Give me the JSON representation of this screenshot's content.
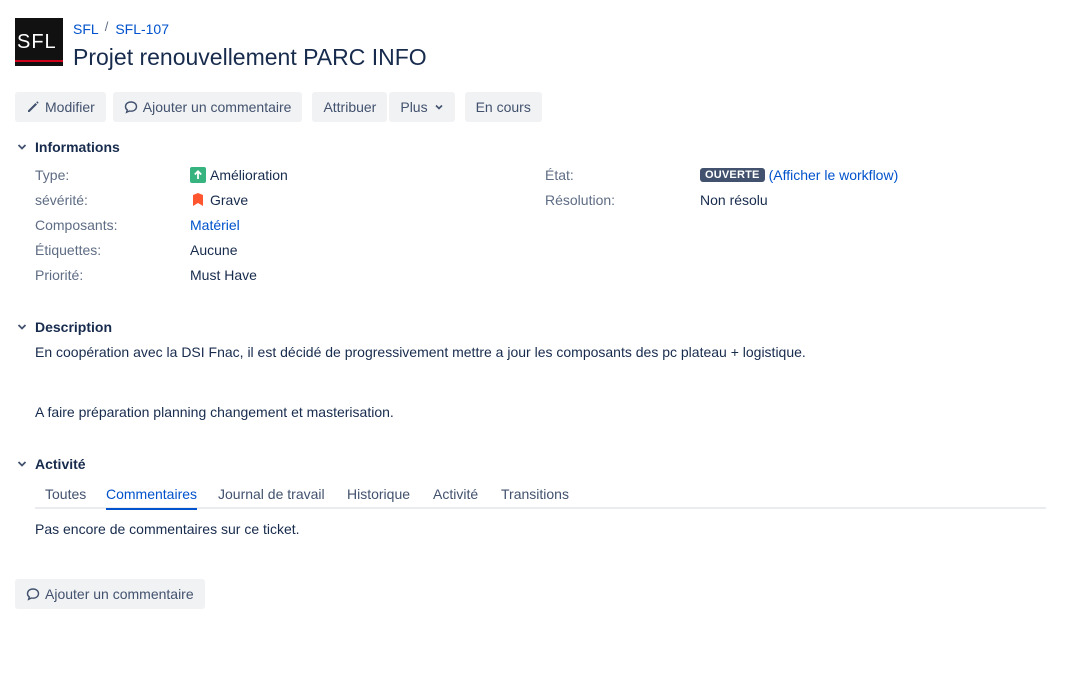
{
  "breadcrumb": {
    "project": "SFL",
    "separator": "/",
    "issue_key": "SFL-107"
  },
  "logo": {
    "text": "SFL"
  },
  "title": "Projet renouvellement PARC INFO",
  "toolbar": {
    "edit_label": "Modifier",
    "comment_label": "Ajouter un commentaire",
    "assign_label": "Attribuer",
    "more_label": "Plus",
    "status_label": "En cours"
  },
  "informations": {
    "heading": "Informations",
    "type_label": "Type:",
    "type_value": "Amélioration",
    "severity_label": "sévérité:",
    "severity_value": "Grave",
    "components_label": "Composants:",
    "components_value": "Matériel",
    "labels_label": "Étiquettes:",
    "labels_value": "Aucune",
    "priority_label": "Priorité:",
    "priority_value": "Must Have",
    "state_label": "État:",
    "state_value": "OUVERTE",
    "workflow_link": "(Afficher le workflow)",
    "resolution_label": "Résolution:",
    "resolution_value": "Non résolu"
  },
  "description": {
    "heading": "Description",
    "line1": "En coopération avec la DSI Fnac, il est décidé de progressivement mettre a jour les composants des pc plateau + logistique.",
    "line2": "A faire préparation planning changement et masterisation."
  },
  "activity": {
    "heading": "Activité",
    "tabs": [
      "Toutes",
      "Commentaires",
      "Journal de travail",
      "Historique",
      "Activité",
      "Transitions"
    ],
    "active_tab": "Commentaires",
    "empty_text": "Pas encore de commentaires sur ce ticket.",
    "add_comment_label": "Ajouter un commentaire"
  },
  "colors": {
    "link": "#0052cc",
    "text": "#172b4d",
    "muted": "#5e6c84",
    "button_bg": "#f1f2f4",
    "type_icon": "#36b37e",
    "severity_icon": "#ff5630",
    "lozenge": "#42526e"
  },
  "icons": {
    "edit": "pencil-icon",
    "comment": "speech-bubble-icon",
    "more": "chevron-down-icon",
    "section_toggle": "chevron-down-icon",
    "type": "arrow-up-icon",
    "severity": "bookmark-icon"
  }
}
